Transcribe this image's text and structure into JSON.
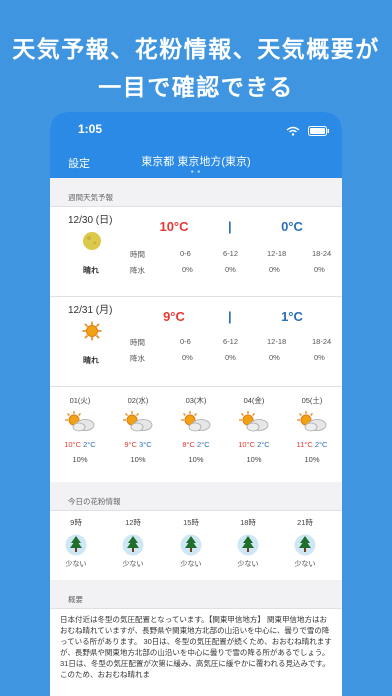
{
  "promo": {
    "line1": "天気予報、花粉情報、天気概要が",
    "line2": "一目で確認できる"
  },
  "status_bar": {
    "time": "1:05"
  },
  "nav": {
    "settings_label": "設定",
    "title": "東京都 東京地方(東京)",
    "page_dots": "● ●"
  },
  "sections": {
    "weekly_forecast": "週間天気予報",
    "pollen": "今日の花粉情報",
    "summary": "概要"
  },
  "periods": {
    "time_label": "時間",
    "rain_label": "降水",
    "slots": [
      "0-6",
      "6-12",
      "12-18",
      "18-24"
    ]
  },
  "days": [
    {
      "date": "12/30 (日)",
      "weather": "晴れ",
      "icon": "moon-icon",
      "high": "10°C",
      "sep": "|",
      "low": "0°C",
      "rain": [
        "0%",
        "0%",
        "0%",
        "0%"
      ]
    },
    {
      "date": "12/31 (月)",
      "weather": "晴れ",
      "icon": "sun-icon",
      "high": "9°C",
      "sep": "|",
      "low": "1°C",
      "rain": [
        "0%",
        "0%",
        "0%",
        "0%"
      ]
    }
  ],
  "weekly": [
    {
      "day": "01(火)",
      "icon": "sun-cloud-icon",
      "high": "10°C",
      "low": "2°C",
      "prob": "10%"
    },
    {
      "day": "02(水)",
      "icon": "sun-cloud-icon",
      "high": "9°C",
      "low": "3°C",
      "prob": "10%"
    },
    {
      "day": "03(木)",
      "icon": "sun-cloud-icon",
      "high": "8°C",
      "low": "2°C",
      "prob": "10%"
    },
    {
      "day": "04(金)",
      "icon": "sun-cloud-icon",
      "high": "10°C",
      "low": "2°C",
      "prob": "10%"
    },
    {
      "day": "05(土)",
      "icon": "sun-cloud-icon",
      "high": "11°C",
      "low": "2°C",
      "prob": "10%"
    }
  ],
  "pollen": [
    {
      "time": "9時",
      "level": "少ない",
      "icon": "tree-icon"
    },
    {
      "time": "12時",
      "level": "少ない",
      "icon": "tree-icon"
    },
    {
      "time": "15時",
      "level": "少ない",
      "icon": "tree-icon"
    },
    {
      "time": "18時",
      "level": "少ない",
      "icon": "tree-icon"
    },
    {
      "time": "21時",
      "level": "少ない",
      "icon": "tree-icon"
    }
  ],
  "summary_text": "日本付近は冬型の気圧配置となっています。【関東甲信地方】 関東甲信地方はおおむね晴れていますが、長野県や関東地方北部の山沿いを中心に、曇りで雪の降っている所があります。 30日は、冬型の気圧配置が続くため、おおむね晴れますが、長野県や関東地方北部の山沿いを中心に曇りで雪の降る所があるでしょう。 31日は、冬型の気圧配置が次第に緩み、高気圧に緩やかに覆われる見込みです。このため、おおむね晴れま",
  "colors": {
    "background": "#3f95df",
    "navbar": "#2b8ae6",
    "high_temp": "#e53935",
    "low_temp": "#2a6fb8"
  }
}
